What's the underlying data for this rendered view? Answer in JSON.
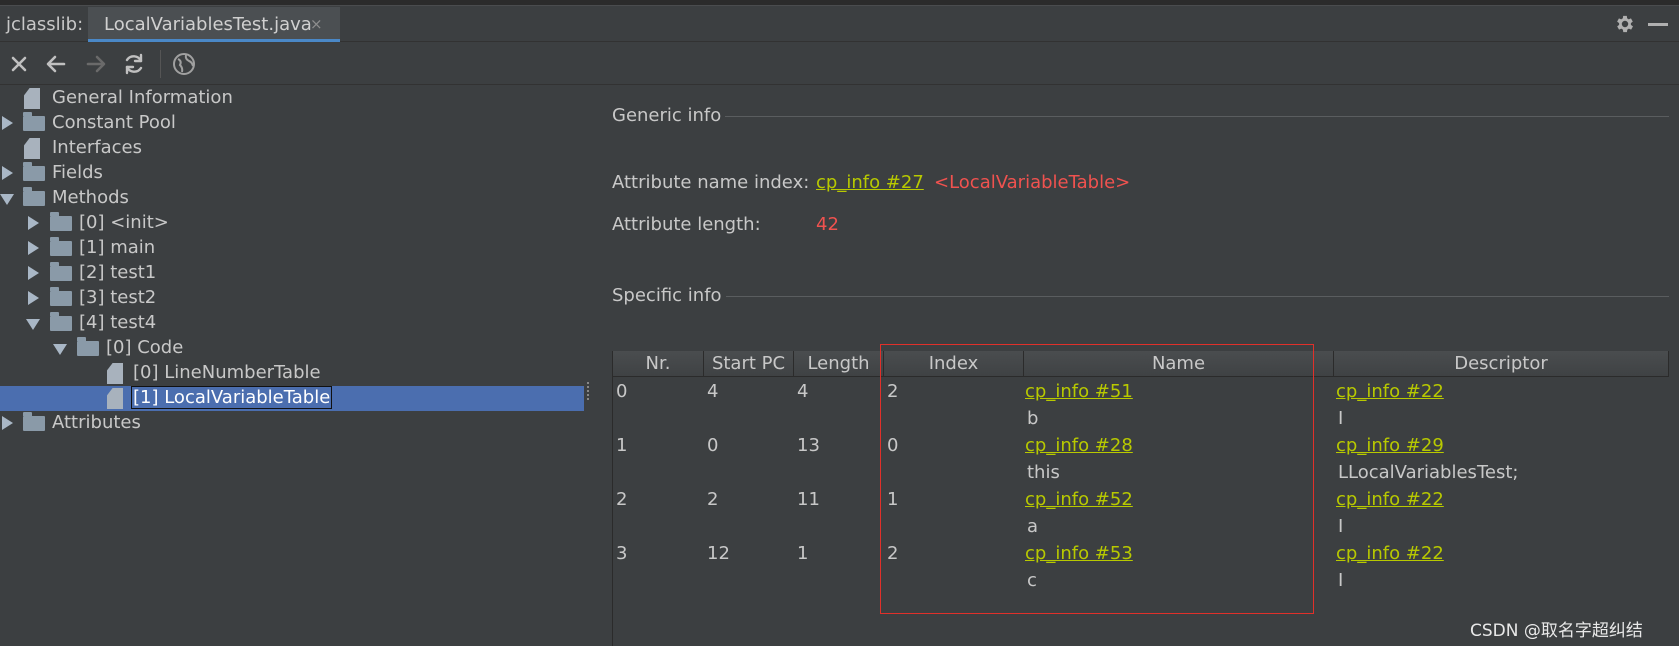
{
  "tool_name": "jclasslib:",
  "tab": {
    "label": "LocalVariablesTest.java",
    "close": "×"
  },
  "tree": {
    "items": [
      {
        "label": "General Information"
      },
      {
        "label": "Constant Pool"
      },
      {
        "label": "Interfaces"
      },
      {
        "label": "Fields"
      },
      {
        "label": "Methods"
      },
      {
        "label": "[0] <init>"
      },
      {
        "label": "[1] main"
      },
      {
        "label": "[2] test1"
      },
      {
        "label": "[3] test2"
      },
      {
        "label": "[4] test4"
      },
      {
        "label": "[0] Code"
      },
      {
        "label": "[0] LineNumberTable"
      },
      {
        "label": "[1] LocalVariableTable"
      },
      {
        "label": "Attributes"
      }
    ]
  },
  "generic": {
    "title": "Generic info",
    "name_index_label": "Attribute name index:",
    "name_index_link": "cp_info #27",
    "name_index_value": "<LocalVariableTable>",
    "length_label": "Attribute length:",
    "length_value": "42"
  },
  "specific": {
    "title": "Specific info",
    "columns": [
      "Nr.",
      "Start PC",
      "Length",
      "Index",
      "Name",
      "Descriptor"
    ],
    "rows": [
      {
        "nr": "0",
        "start_pc": "4",
        "length": "4",
        "index": "2",
        "name_link": "cp_info #51",
        "name": "b",
        "desc_link": "cp_info #22",
        "desc": "I"
      },
      {
        "nr": "1",
        "start_pc": "0",
        "length": "13",
        "index": "0",
        "name_link": "cp_info #28",
        "name": "this",
        "desc_link": "cp_info #29",
        "desc": "LLocalVariablesTest;"
      },
      {
        "nr": "2",
        "start_pc": "2",
        "length": "11",
        "index": "1",
        "name_link": "cp_info #52",
        "name": "a",
        "desc_link": "cp_info #22",
        "desc": "I"
      },
      {
        "nr": "3",
        "start_pc": "12",
        "length": "1",
        "index": "2",
        "name_link": "cp_info #53",
        "name": "c",
        "desc_link": "cp_info #22",
        "desc": "I"
      }
    ]
  },
  "watermark": "CSDN @取名字超纠结",
  "colors": {
    "link": "#b8c900",
    "highlight": "#f0524f",
    "selection": "#4b6eaf"
  }
}
